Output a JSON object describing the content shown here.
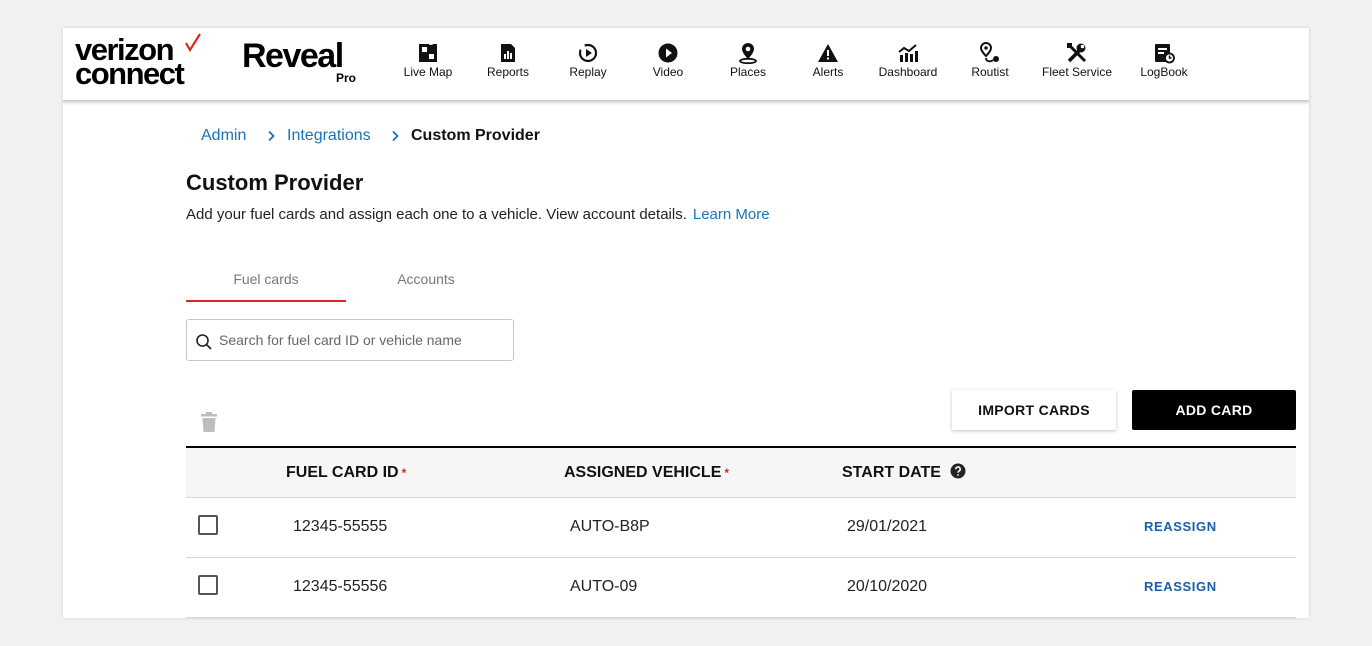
{
  "brand": {
    "logo_line1": "verizon",
    "logo_line2": "connect",
    "product": "Reveal",
    "product_tier": "Pro",
    "accent_color": "#d52b1e"
  },
  "nav": [
    {
      "label": "Live Map",
      "icon": "map-icon"
    },
    {
      "label": "Reports",
      "icon": "reports-icon"
    },
    {
      "label": "Replay",
      "icon": "replay-icon"
    },
    {
      "label": "Video",
      "icon": "video-play-icon"
    },
    {
      "label": "Places",
      "icon": "places-pin-icon"
    },
    {
      "label": "Alerts",
      "icon": "alert-icon"
    },
    {
      "label": "Dashboard",
      "icon": "dashboard-chart-icon"
    },
    {
      "label": "Routist",
      "icon": "route-icon"
    },
    {
      "label": "Fleet Service",
      "icon": "tools-icon"
    },
    {
      "label": "LogBook",
      "icon": "logbook-icon"
    }
  ],
  "breadcrumb": {
    "items": [
      "Admin",
      "Integrations"
    ],
    "current": "Custom Provider"
  },
  "page": {
    "title": "Custom Provider",
    "description": "Add your fuel cards and assign each one to a vehicle. View account details.",
    "learn_more": "Learn More"
  },
  "tabs": [
    {
      "label": "Fuel cards",
      "active": true
    },
    {
      "label": "Accounts",
      "active": false
    }
  ],
  "search": {
    "placeholder": "Search for fuel card ID or vehicle name",
    "value": ""
  },
  "actions": {
    "import_label": "IMPORT CARDS",
    "add_label": "ADD CARD"
  },
  "table": {
    "columns": {
      "fuel_card_id": "FUEL CARD ID",
      "assigned_vehicle": "ASSIGNED VEHICLE",
      "start_date": "START DATE",
      "required_mark": "*"
    },
    "rows": [
      {
        "fuel_card_id": "12345-55555",
        "vehicle": "AUTO-B8P",
        "start_date": "29/01/2021",
        "action": "REASSIGN"
      },
      {
        "fuel_card_id": "12345-55556",
        "vehicle": "AUTO-09",
        "start_date": "20/10/2020",
        "action": "REASSIGN"
      }
    ]
  }
}
